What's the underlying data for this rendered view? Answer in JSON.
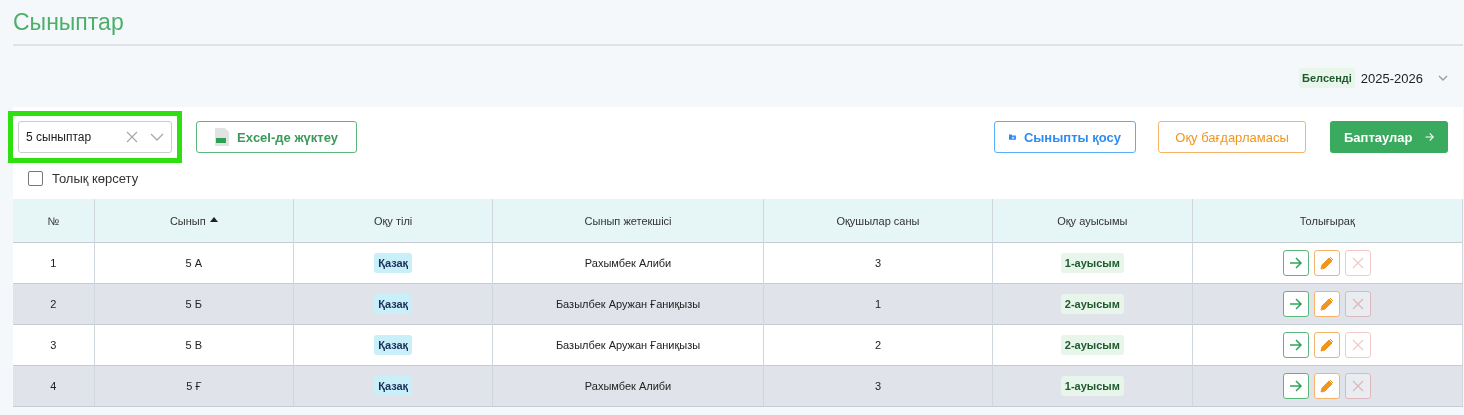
{
  "title": "Сыныптар",
  "year": {
    "status": "Белсенді",
    "value": "2025-2026"
  },
  "toolbar": {
    "class_select": {
      "value": "5 сыныптар",
      "highlighted": true
    },
    "export_button": "Excel-де жүктеу",
    "add_button": "Сыныпты қосу",
    "program_button": "Оқу бағдарламасы",
    "settings_button": "Баптаулар"
  },
  "full_view": {
    "label": "Толық көрсету",
    "checked": false
  },
  "table": {
    "columns": [
      {
        "label": "№",
        "sorted": false
      },
      {
        "label": "Сынып",
        "sorted": true
      },
      {
        "label": "Оқу тілі",
        "sorted": false
      },
      {
        "label": "Сынып жетекшісі",
        "sorted": false
      },
      {
        "label": "Оқушылар саны",
        "sorted": false
      },
      {
        "label": "Оқу ауысымы",
        "sorted": false
      },
      {
        "label": "Толығырақ",
        "sorted": false
      }
    ],
    "rows": [
      {
        "num": "1",
        "class": "5 А",
        "language": "Қазақ",
        "teacher": "Рахымбек Алиби",
        "students": "3",
        "shift": "1-ауысым",
        "delete_disabled": true
      },
      {
        "num": "2",
        "class": "5 Б",
        "language": "Қазақ",
        "teacher": "Базылбек Аружан Ғаниқызы",
        "students": "1",
        "shift": "2-ауысым",
        "delete_disabled": true
      },
      {
        "num": "3",
        "class": "5 В",
        "language": "Қазақ",
        "teacher": "Базылбек Аружан Ғаниқызы",
        "students": "2",
        "shift": "2-ауысым",
        "delete_disabled": true
      },
      {
        "num": "4",
        "class": "5 Ғ",
        "language": "Қазақ",
        "teacher": "Рахымбек Алиби",
        "students": "3",
        "shift": "1-ауысым",
        "delete_disabled": true
      }
    ]
  }
}
